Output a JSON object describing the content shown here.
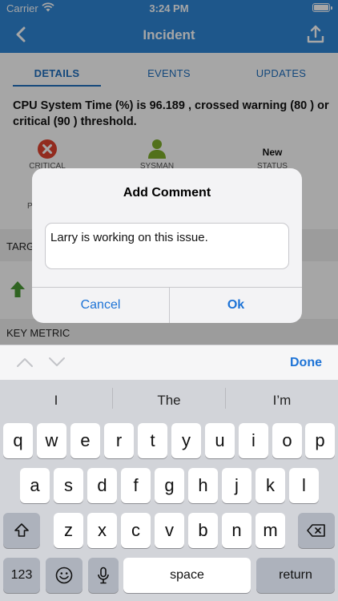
{
  "status_bar": {
    "carrier": "Carrier",
    "time": "3:24 PM"
  },
  "nav": {
    "title": "Incident",
    "back_icon": "chevron-left-icon",
    "share_icon": "share-upload-icon"
  },
  "tabs": [
    {
      "label": "DETAILS",
      "selected": true
    },
    {
      "label": "EVENTS",
      "selected": false
    },
    {
      "label": "UPDATES",
      "selected": false
    }
  ],
  "incident": {
    "summary": "CPU System Time (%) is 96.189 , crossed warning (80 ) or critical (90 ) threshold.",
    "stats": [
      {
        "label": "CRITICAL",
        "icon": "critical-x-icon",
        "color": "#e0432f"
      },
      {
        "label": "SYSMAN",
        "icon": "user-icon",
        "color": "#7fae2a"
      },
      {
        "value": "New",
        "label": "STATUS"
      }
    ],
    "partial_label": "P",
    "section_target": "TARG",
    "section_key_metric": "KEY METRIC"
  },
  "dialog": {
    "title": "Add Comment",
    "field_value": "Larry is working on this issue.",
    "cancel_label": "Cancel",
    "ok_label": "Ok"
  },
  "accessory": {
    "done_label": "Done"
  },
  "keyboard": {
    "suggestions": [
      "I",
      "The",
      "I’m"
    ],
    "row1": [
      "q",
      "w",
      "e",
      "r",
      "t",
      "y",
      "u",
      "i",
      "o",
      "p"
    ],
    "row2": [
      "a",
      "s",
      "d",
      "f",
      "g",
      "h",
      "j",
      "k",
      "l"
    ],
    "row3": [
      "z",
      "x",
      "c",
      "v",
      "b",
      "n",
      "m"
    ],
    "numbers_label": "123",
    "space_label": "space",
    "return_label": "return"
  },
  "colors": {
    "brand_blue": "#2f86d6",
    "link_blue": "#1d73d6",
    "critical_red": "#e0432f",
    "user_green": "#7fae2a"
  }
}
